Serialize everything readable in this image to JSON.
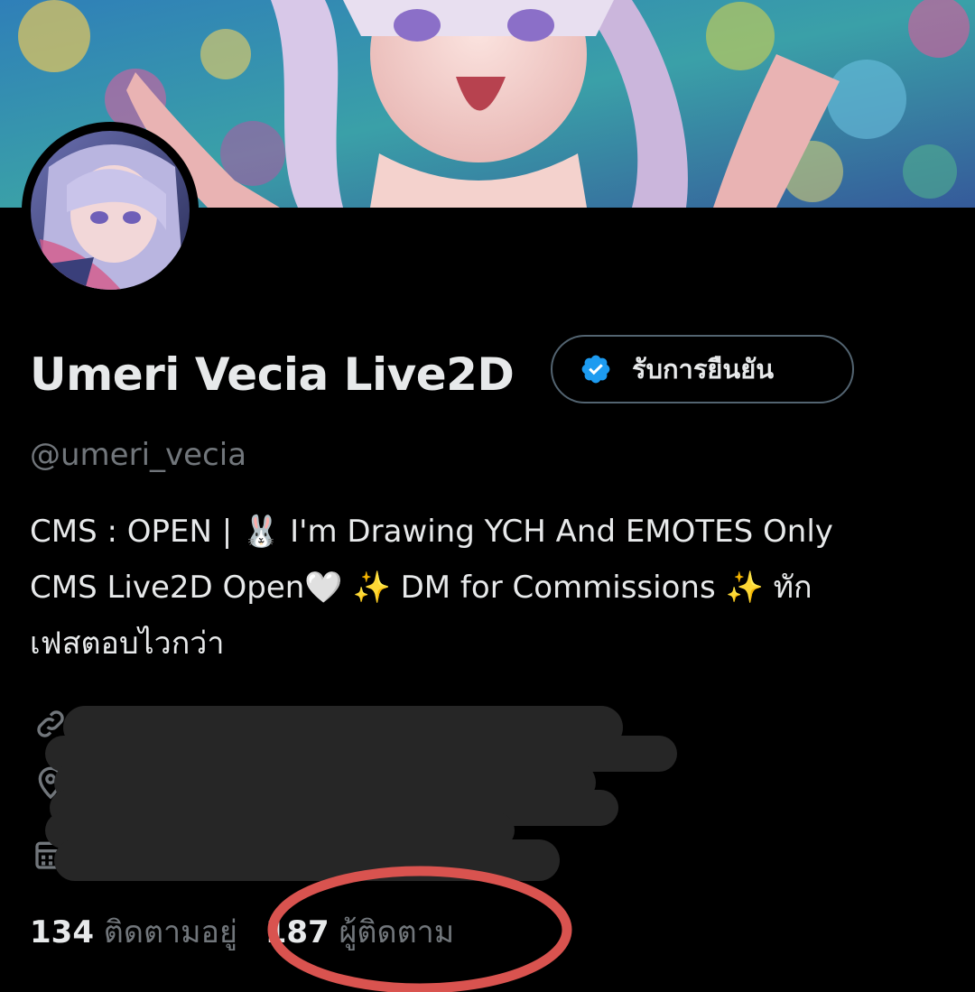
{
  "profile": {
    "display_name": "Umeri Vecia Live2D",
    "handle": "@umeri_vecia",
    "verify_button_label": "รับการยืนยัน",
    "bio_lines": [
      "CMS : OPEN | 🐰 I'm Drawing YCH And EMOTES Only",
      "CMS Live2D Open🤍  ✨ DM for Commissions ✨  ทัก",
      "เฟสตอบไวกว่า"
    ]
  },
  "stats": {
    "following_count": "134",
    "following_label": "ติดตามอยู่",
    "followers_count": "187",
    "followers_label": "ผู้ติดตาม"
  },
  "meta_icons": [
    "link-icon",
    "location-icon",
    "calendar-icon"
  ],
  "colors": {
    "background": "#000000",
    "primary_text": "#e7e9ea",
    "secondary_text": "#71767b",
    "verified_blue": "#1d9bf0",
    "border": "#536471",
    "highlight_circle": "#d9534f"
  }
}
